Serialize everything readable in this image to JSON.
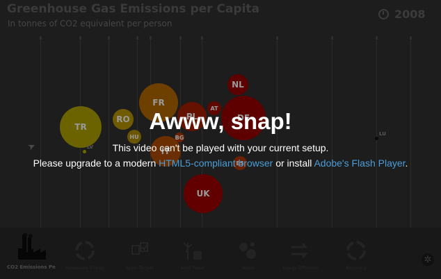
{
  "chart": {
    "title": "Greenhouse Gas Emissions per Capita",
    "subtitle": "In tonnes of CO2 equivalent per person",
    "year": "2008",
    "tick_marks": [
      "8",
      "8",
      "8",
      "8",
      "8",
      "8",
      "8",
      "8",
      "8",
      "8",
      "8",
      "8"
    ],
    "bubbles": [
      {
        "label": "TR",
        "color": "#6a6300"
      },
      {
        "label": "RO",
        "color": "#715b00"
      },
      {
        "label": "FR",
        "color": "#6e4000"
      },
      {
        "label": "PL",
        "color": "#661200"
      },
      {
        "label": "DE",
        "color": "#5e0000"
      },
      {
        "label": "UK",
        "color": "#620000"
      },
      {
        "label": "NL",
        "color": "#5c0000"
      },
      {
        "label": "AT",
        "color": "#5f0800"
      },
      {
        "label": "HU",
        "color": "#6a5500"
      },
      {
        "label": "BG",
        "color": "#6c2200"
      },
      {
        "label": "IT",
        "color": "#6a2e00"
      },
      {
        "label": "ES",
        "color": "#6a2000"
      },
      {
        "label": "LV",
        "color": "#6f6a00"
      },
      {
        "label": "LU",
        "color": "#000000"
      }
    ]
  },
  "nav": {
    "active_label": "CO2 Emissions Pe",
    "item_labels": [
      "Renewable Energy",
      "Kyoto Targets",
      "Wind Power",
      "Waste",
      "Energy Efficiency",
      "Recycling"
    ]
  },
  "overlay": {
    "title": "Awww, snap!",
    "line1": "This video can't be played with your current setup.",
    "line2_prefix": "Please upgrade to a modern ",
    "link1": "HTML5-compliant browser",
    "line2_middle": " or install ",
    "link2": "Adobe's Flash Player",
    "line2_suffix": "."
  }
}
